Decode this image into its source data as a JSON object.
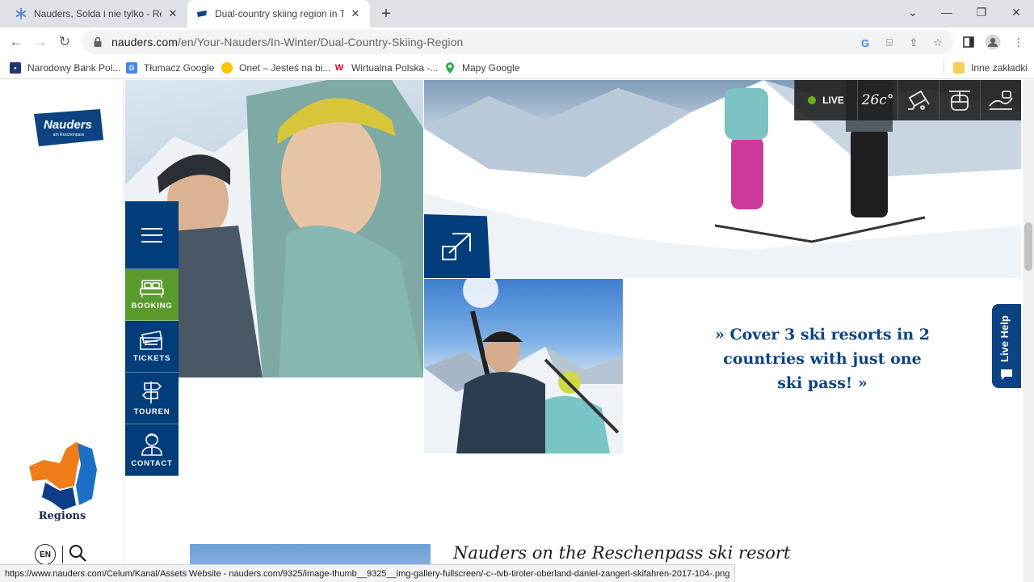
{
  "browser": {
    "tabs": [
      {
        "title": "Nauders, Solda i nie tylko - Relac",
        "active": false
      },
      {
        "title": "Dual-country skiing region in Tyr",
        "active": true
      }
    ],
    "url_host": "nauders.com",
    "url_path": "/en/Your-Nauders/In-Winter/Dual-Country-Skiing-Region",
    "bookmarks": [
      {
        "label": "Narodowy Bank Pol...",
        "icon": "nbp-icon"
      },
      {
        "label": "Tłumacz Google",
        "icon": "google-translate-icon"
      },
      {
        "label": "Onet – Jesteś na bi...",
        "icon": "onet-icon"
      },
      {
        "label": "Wirtualna Polska -...",
        "icon": "wp-icon"
      },
      {
        "label": "Mapy Google",
        "icon": "maps-pin-icon"
      }
    ],
    "other_bookmarks": "Inne zakładki",
    "status_url": "https://www.nauders.com/Celum/Kanal/Assets Website - nauders.com/9325/image-thumb__9325__img-gallery-fullscreen/-c--tvb-tiroler-oberland-daniel-zangerl-skifahren-2017-104-.png"
  },
  "site": {
    "logo": {
      "name": "Nauders",
      "tagline": "am Reschenpass",
      "color": "#0d4382"
    },
    "regions_label": "Regions",
    "language": "EN",
    "side_menu": [
      {
        "id": "menu",
        "label": "",
        "icon": "hamburger-icon"
      },
      {
        "id": "booking",
        "label": "BOOKING",
        "icon": "bed-icon"
      },
      {
        "id": "tickets",
        "label": "TICKETS",
        "icon": "ticket-icon"
      },
      {
        "id": "touren",
        "label": "TOUREN",
        "icon": "signpost-icon"
      },
      {
        "id": "contact",
        "label": "CONTACT",
        "icon": "person-icon"
      }
    ],
    "info_strip": {
      "live": "LIVE",
      "temperature": "26c°"
    },
    "quote": "» Cover 3 ski resorts in 2 countries with just one ski pass! »",
    "live_help": "Live Help",
    "ski_heading": "Nauders on the Reschenpass ski resort",
    "colors": {
      "brand_blue": "#0d4382",
      "menu_blue": "#003d7a",
      "booking_green": "#5b9a2d",
      "live_green": "#67b31f"
    }
  }
}
